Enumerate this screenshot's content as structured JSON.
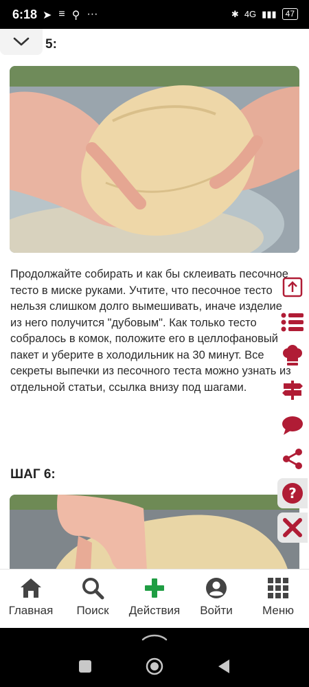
{
  "status": {
    "time": "6:18",
    "battery": "47",
    "network": "4G"
  },
  "steps": [
    {
      "title": "5:"
    },
    {
      "title": "ШАГ 6:"
    }
  ],
  "step5_text": "Продолжайте собирать и как бы склеивать песочное тесто в миске руками. Учтите, что песочное тесто нельзя слишком долго вымешивать, иначе изделие из него получится \"дубовым\". Как только тесто собралось в комок, положите его в целлофановый пакет и уберите в холодильник на 30 минут. Все секреты выпечки из песочного теста можно узнать из отдельной статьи, ссылка внизу под шагами.",
  "side_icons": [
    "scroll-up-icon",
    "list-icon",
    "chef-hat-icon",
    "signpost-icon",
    "comment-icon",
    "share-icon",
    "help-icon",
    "close-icon"
  ],
  "nav": [
    {
      "label": "Главная",
      "icon": "home-icon"
    },
    {
      "label": "Поиск",
      "icon": "search-icon"
    },
    {
      "label": "Действия",
      "icon": "plus-icon"
    },
    {
      "label": "Войти",
      "icon": "user-icon"
    },
    {
      "label": "Меню",
      "icon": "grid-icon"
    }
  ],
  "colors": {
    "accent": "#b01c35",
    "plus": "#1f9d43",
    "nav_icon": "#444444"
  }
}
